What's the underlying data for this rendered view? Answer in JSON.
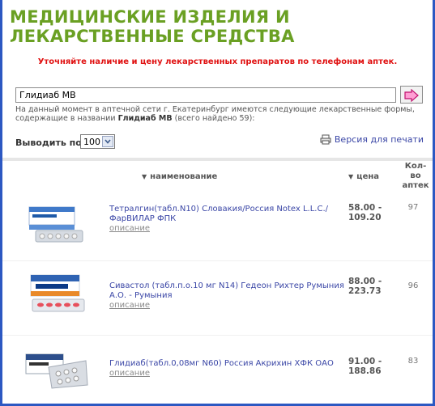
{
  "page": {
    "title": "МЕДИЦИНСКИЕ ИЗДЕЛИЯ И ЛЕКАРСТВЕННЫЕ СРЕДСТВА",
    "notice": "Уточняйте наличие и цену лекарственных препаратов по телефонам аптек."
  },
  "search": {
    "value": "Глидиаб МВ",
    "go_icon": "arrow-right-icon"
  },
  "info": {
    "line1": "На данный момент в аптечной сети г. Екатеринбург имеются следующие лекарственные формы,",
    "line2_prefix": "содержащие в названии ",
    "query": "Глидиаб МВ",
    "found": "(всего найдено 59):"
  },
  "controls": {
    "perpage_label": "Выводить по",
    "perpage_value": "100",
    "print_label": "Версия для печати",
    "print_icon": "printer-icon"
  },
  "table": {
    "col_name": "наименование",
    "col_price": "цена",
    "col_qty_1": "Кол-",
    "col_qty_2": "во",
    "col_qty_3": "аптек",
    "sort_icon": "triangle-down-icon",
    "rows": [
      {
        "name": "Тетралгин(табл.N10) Словакия/Россия Notex L.L.C./ФарВИЛАР ФПК",
        "desc": "описание",
        "price_min": "58.00 -",
        "price_max": "109.20",
        "qty": "97"
      },
      {
        "name": "Сивастол (табл.п.о.10 мг N14) Гедеон Рихтер Румыния А.О. - Румыния",
        "desc": "описание",
        "price_min": "88.00 -",
        "price_max": "223.73",
        "qty": "96"
      },
      {
        "name": "Глидиаб(табл.0,08мг N60) Россия Акрихин ХФК ОАО",
        "desc": "описание",
        "price_min": "91.00 -",
        "price_max": "188.86",
        "qty": "83"
      }
    ]
  }
}
